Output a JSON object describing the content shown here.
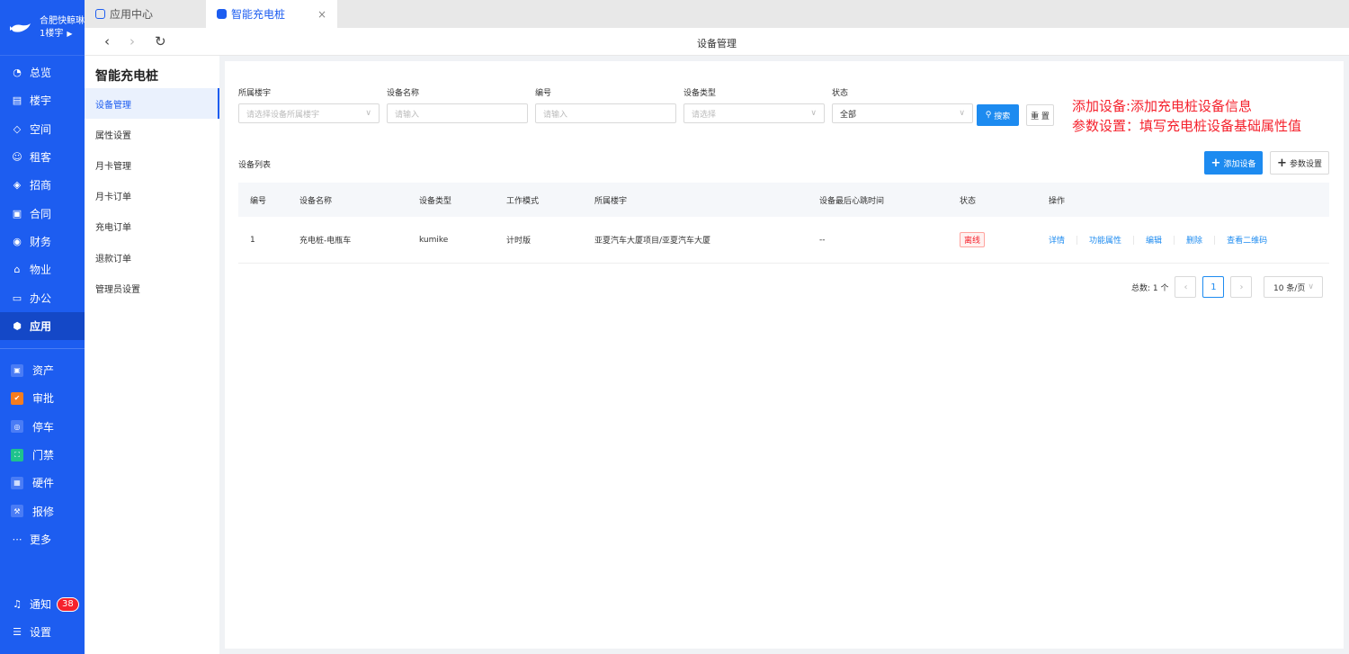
{
  "brand": {
    "name": "合肥快鲸琳",
    "building": "1楼宇"
  },
  "nav": {
    "items": [
      {
        "label": "总览",
        "icon": "dashboard-icon"
      },
      {
        "label": "楼宇",
        "icon": "building-icon"
      },
      {
        "label": "空间",
        "icon": "cube-icon"
      },
      {
        "label": "租客",
        "icon": "users-icon"
      },
      {
        "label": "招商",
        "icon": "tag-icon"
      },
      {
        "label": "合同",
        "icon": "document-icon"
      },
      {
        "label": "财务",
        "icon": "finance-icon"
      },
      {
        "label": "物业",
        "icon": "home-icon"
      },
      {
        "label": "办公",
        "icon": "monitor-icon"
      },
      {
        "label": "应用",
        "icon": "app-icon"
      }
    ],
    "apps": [
      {
        "label": "资产",
        "color": "#4a7cf5"
      },
      {
        "label": "审批",
        "color": "#f57c1f"
      },
      {
        "label": "停车",
        "color": "#4a7cf5"
      },
      {
        "label": "门禁",
        "color": "#1fc28c"
      },
      {
        "label": "硬件",
        "color": "#4a7cf5"
      },
      {
        "label": "报修",
        "color": "#4a7cf5"
      }
    ],
    "more": "更多",
    "notify": "通知",
    "notify_count": "38",
    "settings": "设置"
  },
  "tabs": [
    {
      "label": "应用中心"
    },
    {
      "label": "智能充电桩",
      "close": "×"
    }
  ],
  "toolbar": {
    "title": "设备管理",
    "back": "‹",
    "forward": "›",
    "refresh": "↻"
  },
  "submenu": {
    "title": "智能充电桩",
    "items": [
      "设备管理",
      "属性设置",
      "月卡管理",
      "月卡订单",
      "充电订单",
      "退款订单",
      "管理员设置"
    ]
  },
  "filters": {
    "building": {
      "label": "所属楼宇",
      "placeholder": "请选择设备所属楼宇"
    },
    "name": {
      "label": "设备名称",
      "placeholder": "请输入"
    },
    "code": {
      "label": "编号",
      "placeholder": "请输入"
    },
    "type": {
      "label": "设备类型",
      "placeholder": "请选择"
    },
    "status": {
      "label": "状态",
      "value": "全部"
    },
    "search_label": "搜索",
    "reset_label": "重 置"
  },
  "note": {
    "line1": "添加设备:添加充电桩设备信息",
    "line2": "参数设置：填写充电桩设备基础属性值"
  },
  "list": {
    "title": "设备列表",
    "add_label": "添加设备",
    "param_label": "参数设置",
    "columns": [
      "编号",
      "设备名称",
      "设备类型",
      "工作模式",
      "所属楼宇",
      "设备最后心跳时间",
      "状态",
      "操作"
    ],
    "rows": [
      {
        "code": "1",
        "name": "充电桩-电瓶车",
        "type": "kumike",
        "mode": "计时版",
        "building": "亚夏汽车大厦项目/亚夏汽车大厦",
        "heartbeat": "--",
        "status": "离线",
        "ops": [
          "详情",
          "功能属性",
          "编辑",
          "删除",
          "查看二维码"
        ]
      }
    ]
  },
  "pager": {
    "total": "总数: 1 个",
    "current": "1",
    "size": "10 条/页",
    "prev": "‹",
    "next": "›"
  }
}
